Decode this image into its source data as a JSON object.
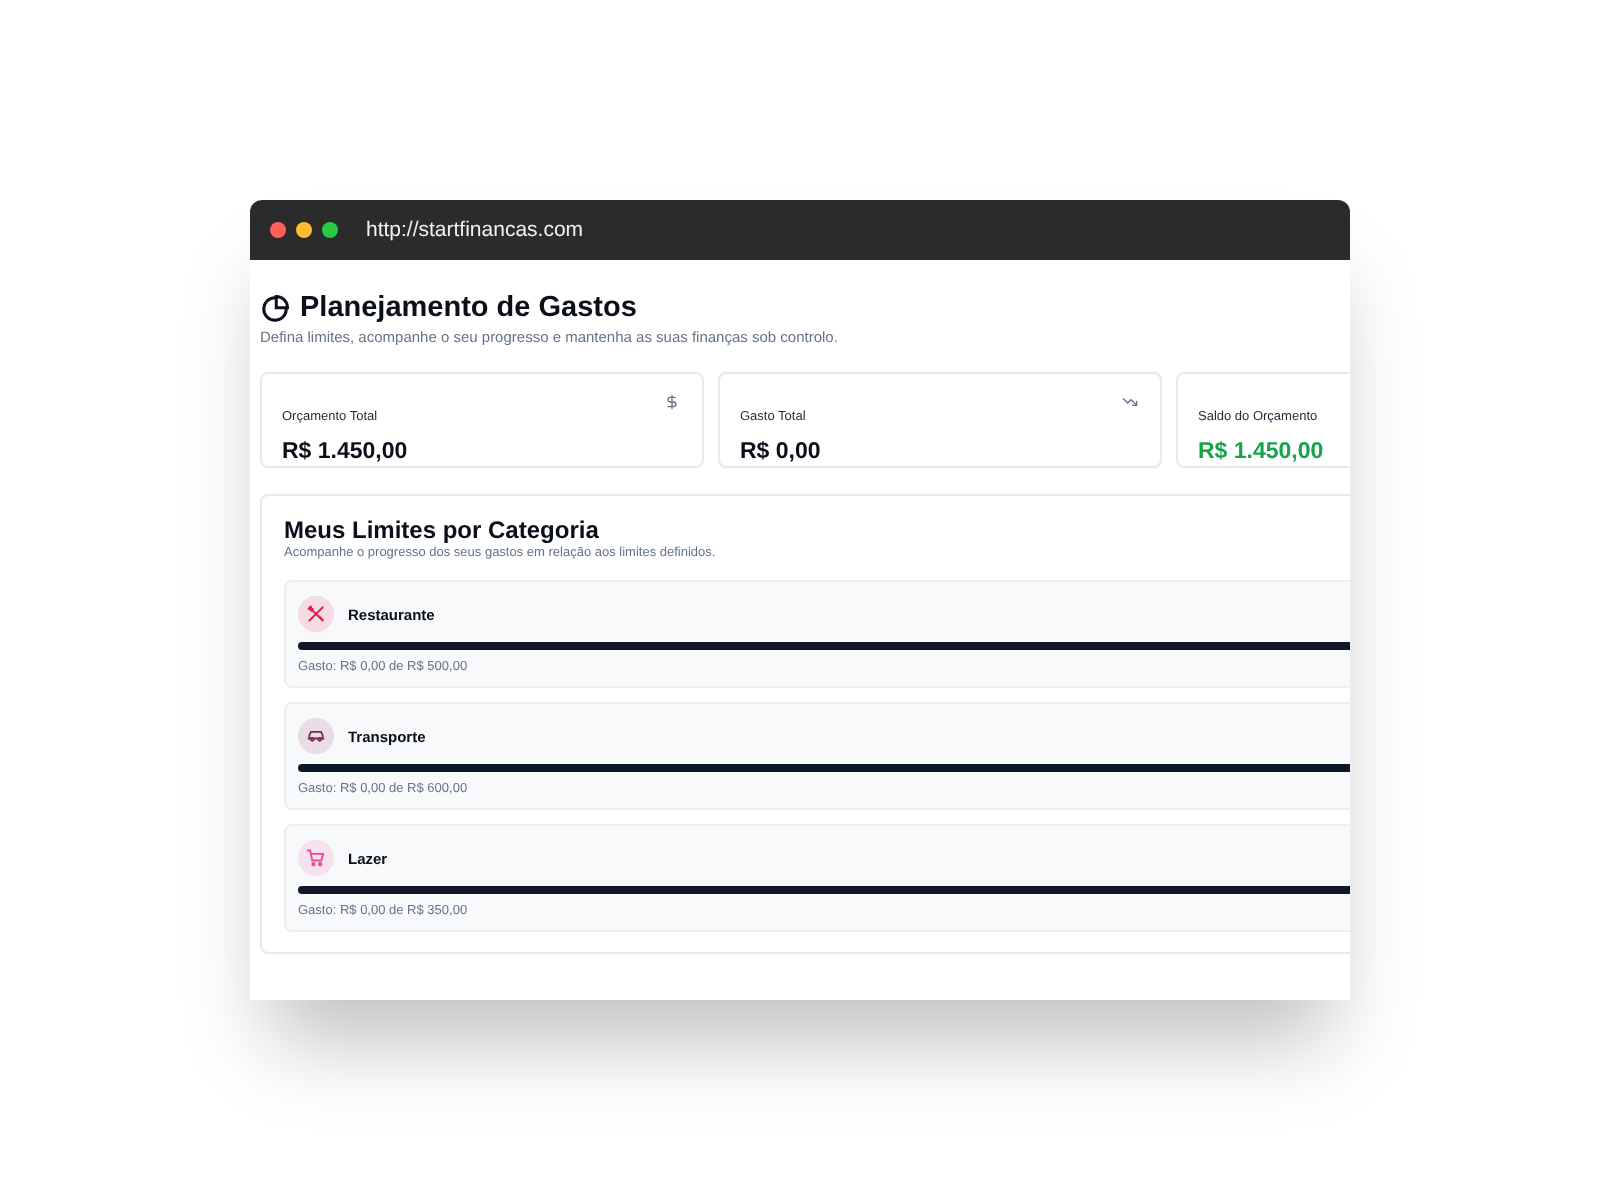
{
  "browser": {
    "url": "http://startfinancas.com"
  },
  "header": {
    "title": "Planejamento de Gastos",
    "subtitle": "Defina limites, acompanhe o seu progresso e mantenha as suas finanças sob controlo."
  },
  "summary_cards": [
    {
      "label": "Orçamento Total",
      "value": "R$ 1.450,00",
      "kind": "budget"
    },
    {
      "label": "Gasto Total",
      "value": "R$ 0,00",
      "kind": "spent"
    },
    {
      "label": "Saldo do Orçamento",
      "value": "R$ 1.450,00",
      "kind": "balance"
    }
  ],
  "categories_panel": {
    "title": "Meus Limites por Categoria",
    "subtitle": "Acompanhe o progresso dos seus gastos em relação aos limites definidos.",
    "items": [
      {
        "name": "Restaurante",
        "kind": "restaurant",
        "color": "#e11d48",
        "level": 1,
        "detail": "Gasto: R$ 0,00 de R$ 500,00"
      },
      {
        "name": "Transporte",
        "kind": "transport",
        "color": "#7e2a5a",
        "level": 1,
        "detail": "Gasto: R$ 0,00 de R$ 600,00"
      },
      {
        "name": "Lazer",
        "kind": "leisure",
        "color": "#ec4899",
        "level": 1,
        "detail": "Gasto: R$ 0,00 de R$ 350,00"
      }
    ]
  }
}
